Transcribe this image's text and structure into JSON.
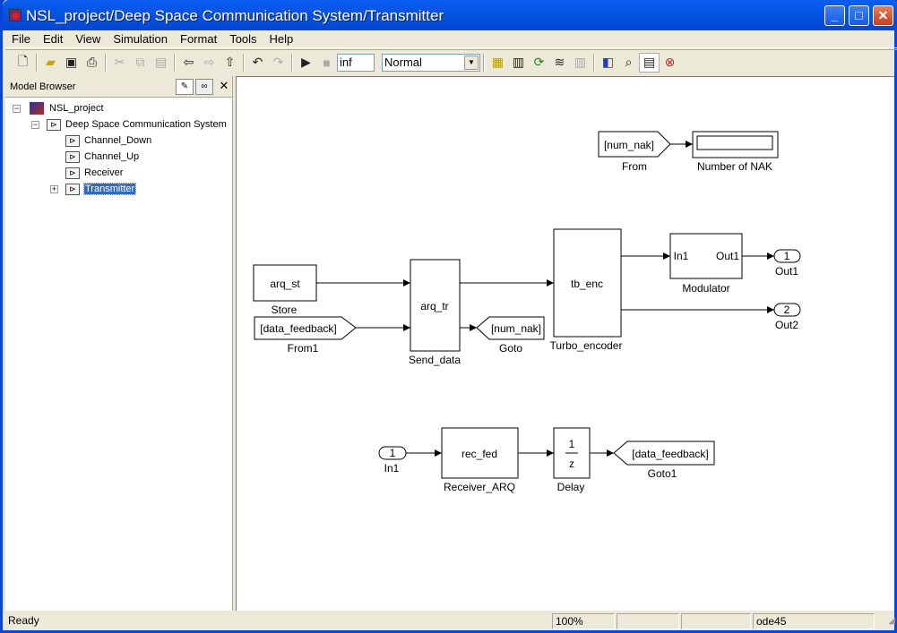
{
  "window": {
    "title": "NSL_project/Deep Space Communication System/Transmitter"
  },
  "menu": [
    "File",
    "Edit",
    "View",
    "Simulation",
    "Format",
    "Tools",
    "Help"
  ],
  "toolbar": {
    "stop_time": "inf",
    "sim_mode": "Normal"
  },
  "browser": {
    "title": "Model Browser",
    "tree": [
      {
        "label": "NSL_project"
      },
      {
        "label": "Deep Space Communication System"
      },
      {
        "label": "Channel_Down"
      },
      {
        "label": "Channel_Up"
      },
      {
        "label": "Receiver"
      },
      {
        "label": "Transmitter",
        "selected": true
      }
    ]
  },
  "diagram": {
    "from": {
      "tag": "[num_nak]",
      "name": "From"
    },
    "display": {
      "name": "Number of NAK"
    },
    "store": {
      "text": "arq_st",
      "name": "Store"
    },
    "from1": {
      "tag": "[data_feedback]",
      "name": "From1"
    },
    "send": {
      "text": "arq_tr",
      "name": "Send_data"
    },
    "goto": {
      "tag": "[num_nak]",
      "name": "Goto"
    },
    "turbo": {
      "text": "tb_enc",
      "name": "Turbo_encoder"
    },
    "modulator": {
      "in": "In1",
      "out": "Out1",
      "name": "Modulator"
    },
    "out1": {
      "num": "1",
      "name": "Out1"
    },
    "out2": {
      "num": "2",
      "name": "Out2"
    },
    "in1": {
      "num": "1",
      "name": "In1"
    },
    "receiver": {
      "text": "rec_fed",
      "name": "Receiver_ARQ"
    },
    "delay": {
      "num": "1",
      "den": "z",
      "name": "Delay"
    },
    "goto1": {
      "tag": "[data_feedback]",
      "name": "Goto1"
    }
  },
  "status": {
    "text": "Ready",
    "zoom": "100%",
    "solver": "ode45"
  }
}
